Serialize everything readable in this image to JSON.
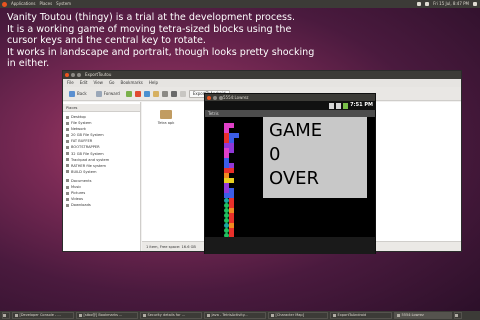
{
  "topbar": {
    "applications": "Applications",
    "places": "Places",
    "system": "System",
    "clock": "Fri 15 Jul, 8:47 PM"
  },
  "caption": {
    "lines": [
      "Vanity Toutou (thingy) is a trial at the development process.",
      "It is a working game of moving tetra-sized blocks using the",
      "cursor keys and the central key to rotate.",
      "It works in landscape and portrait, though looks pretty shocking",
      "in either."
    ]
  },
  "file_manager": {
    "window_title": "ExportToutou",
    "menu": [
      "File",
      "Edit",
      "View",
      "Go",
      "Bookmarks",
      "Help"
    ],
    "toolbar": {
      "back": "Back",
      "forward": "Forward",
      "path_button": "ExportToAndroid"
    },
    "sidebar_header": "Places",
    "places": [
      "Desktop",
      "File System",
      "Network",
      "20 GB File System",
      "FAT BUFFER",
      "BOOTSTRAPPER",
      "32 GB File System",
      "Trackpad and system",
      "RATHER file system",
      "BUILD System"
    ],
    "devices": [
      "Documents",
      "Music",
      "Pictures",
      "Videos",
      "Downloads"
    ],
    "folder_label": "Tetra apk",
    "status": "1 item, Free space: 16.6 GB"
  },
  "emulator": {
    "window_title": "5554:Lowrez",
    "status_clock": "7:51 PM",
    "app_title": "Tetris",
    "game_over_lines": [
      "GAME",
      "0",
      "OVER"
    ]
  },
  "taskbar": {
    "tasks": [
      {
        "label": "[Developer Console - ...",
        "active": false
      },
      {
        "label": "[stbo@] Bookmarks ...",
        "active": false
      },
      {
        "label": "Security details for ...",
        "active": false
      },
      {
        "label": "Java - TetrisActivity...",
        "active": false
      },
      {
        "label": "[Character Map]",
        "active": false
      },
      {
        "label": "ExportToAndroid",
        "active": false
      },
      {
        "label": "5554:Lowrez",
        "active": true
      }
    ]
  },
  "game_board": {
    "colors": {
      "red": "#e8302a",
      "magenta": "#e040c8",
      "blue": "#3b5de8",
      "green": "#20c060",
      "teal": "#1aa8a0",
      "orange": "#f08a20",
      "yellow": "#e8d020",
      "purple": "#9038d8"
    }
  }
}
